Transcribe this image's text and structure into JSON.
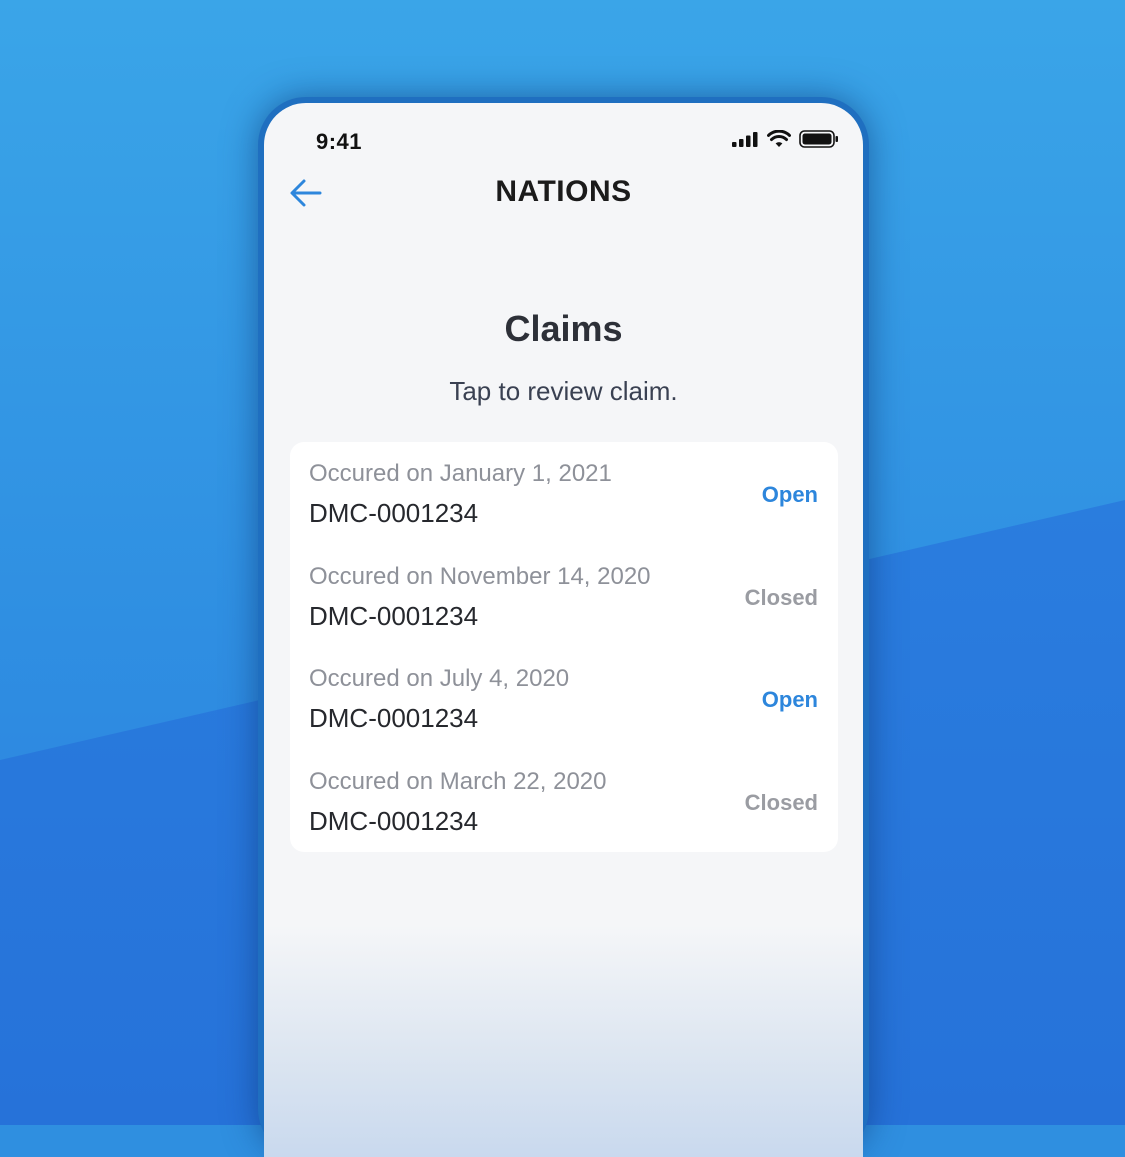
{
  "status_bar": {
    "time": "9:41",
    "icons": [
      "signal-icon",
      "wifi-icon",
      "battery-icon"
    ]
  },
  "nav": {
    "back_icon": "arrow-left-icon",
    "brand": "NATIONS"
  },
  "page": {
    "title": "Claims",
    "subtitle": "Tap to review claim."
  },
  "claims": [
    {
      "date": "Occured on January 1, 2021",
      "id": "DMC-0001234",
      "status": "Open"
    },
    {
      "date": "Occured on November 14, 2020",
      "id": "DMC-0001234",
      "status": "Closed"
    },
    {
      "date": "Occured on July 4, 2020",
      "id": "DMC-0001234",
      "status": "Open"
    },
    {
      "date": "Occured on March 22, 2020",
      "id": "DMC-0001234",
      "status": "Closed"
    }
  ],
  "colors": {
    "accent": "#2d86dc",
    "closed": "#9a9ca2",
    "background": "#3aa5e8",
    "screen": "#f5f6f8"
  }
}
